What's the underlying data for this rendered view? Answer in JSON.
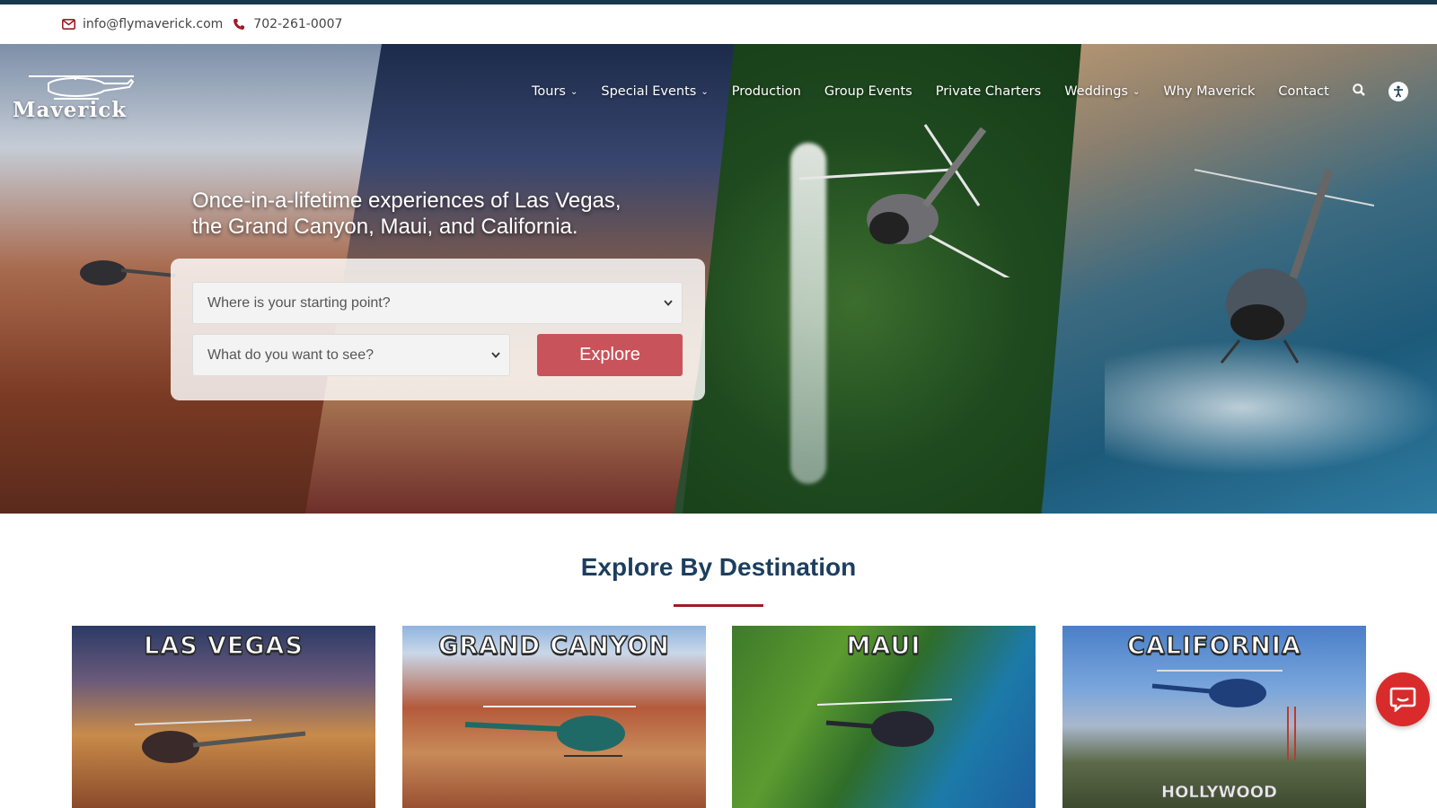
{
  "topbar": {
    "email": "info@flymaverick.com",
    "phone": "702-261-0007",
    "icons": [
      "envelope-icon",
      "phone-icon"
    ]
  },
  "brand": {
    "logo_text": "Maverick",
    "accent_color": "#9e1c24",
    "primary_color": "#1d3e5e",
    "button_color": "#c9535b"
  },
  "nav": {
    "items": [
      {
        "label": "Tours",
        "has_dropdown": true
      },
      {
        "label": "Special Events",
        "has_dropdown": true
      },
      {
        "label": "Production",
        "has_dropdown": false
      },
      {
        "label": "Group Events",
        "has_dropdown": false
      },
      {
        "label": "Private Charters",
        "has_dropdown": false
      },
      {
        "label": "Weddings",
        "has_dropdown": true
      },
      {
        "label": "Why Maverick",
        "has_dropdown": false
      },
      {
        "label": "Contact",
        "has_dropdown": false
      }
    ],
    "icons": [
      "search-icon",
      "accessibility-icon"
    ]
  },
  "hero": {
    "headline_line1": "Once-in-a-lifetime experiences of Las Vegas,",
    "headline_line2": "the Grand Canyon, Maui, and California.",
    "start_select_value": "Where is your starting point?",
    "see_select_value": "What do you want to see?",
    "explore_label": "Explore"
  },
  "destinations": {
    "title": "Explore By Destination",
    "cards": [
      {
        "title": "LAS VEGAS"
      },
      {
        "title": "GRAND CANYON"
      },
      {
        "title": "MAUI"
      },
      {
        "title": "CALIFORNIA",
        "sign_text": "HOLLYWOOD"
      }
    ]
  },
  "chat": {
    "icon": "chat-icon"
  }
}
